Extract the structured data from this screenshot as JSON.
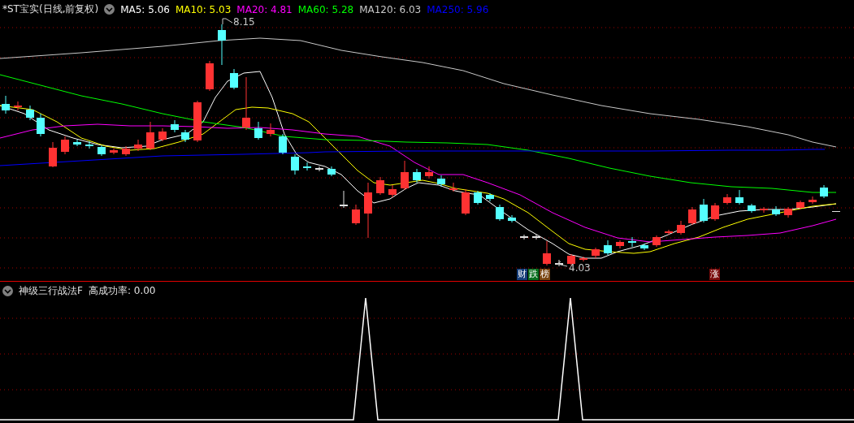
{
  "title": "*ST宝实(日线,前复权)",
  "moving_averages": [
    {
      "label": "MA5: 5.06",
      "color": "#ffffff"
    },
    {
      "label": "MA10: 5.03",
      "color": "#ffff00"
    },
    {
      "label": "MA20: 4.81",
      "color": "#ff00ff"
    },
    {
      "label": "MA60: 5.28",
      "color": "#00ff00"
    },
    {
      "label": "MA120: 6.03",
      "color": "#c8c8c8"
    },
    {
      "label": "MA250: 5.96",
      "color": "#0000ff"
    }
  ],
  "price_marks": [
    {
      "kind": "high",
      "text": "8.15"
    },
    {
      "kind": "low",
      "text": "4.03"
    }
  ],
  "badges": [
    {
      "text": "财",
      "color": "#143c78"
    },
    {
      "text": "跌",
      "color": "#0a6e1e"
    },
    {
      "text": "榜",
      "color": "#7a4612"
    },
    {
      "text": "涨",
      "color": "#780a0a"
    }
  ],
  "indicator_panel": {
    "title": "神级三行战法F",
    "readout": "高成功率: 0.00"
  }
}
